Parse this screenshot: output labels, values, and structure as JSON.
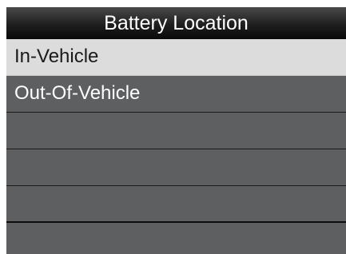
{
  "title": "Battery Location",
  "menu": {
    "items": [
      {
        "label": "In-Vehicle",
        "selected": true
      },
      {
        "label": "Out-Of-Vehicle",
        "selected": false
      },
      {
        "label": "",
        "selected": false
      },
      {
        "label": "",
        "selected": false
      },
      {
        "label": "",
        "selected": false
      },
      {
        "label": "",
        "selected": false
      }
    ]
  },
  "colors": {
    "background": "#5e5f61",
    "selected": "#dcdcdc",
    "title_bar": "#1e1e1e",
    "text": "#ffffff"
  }
}
